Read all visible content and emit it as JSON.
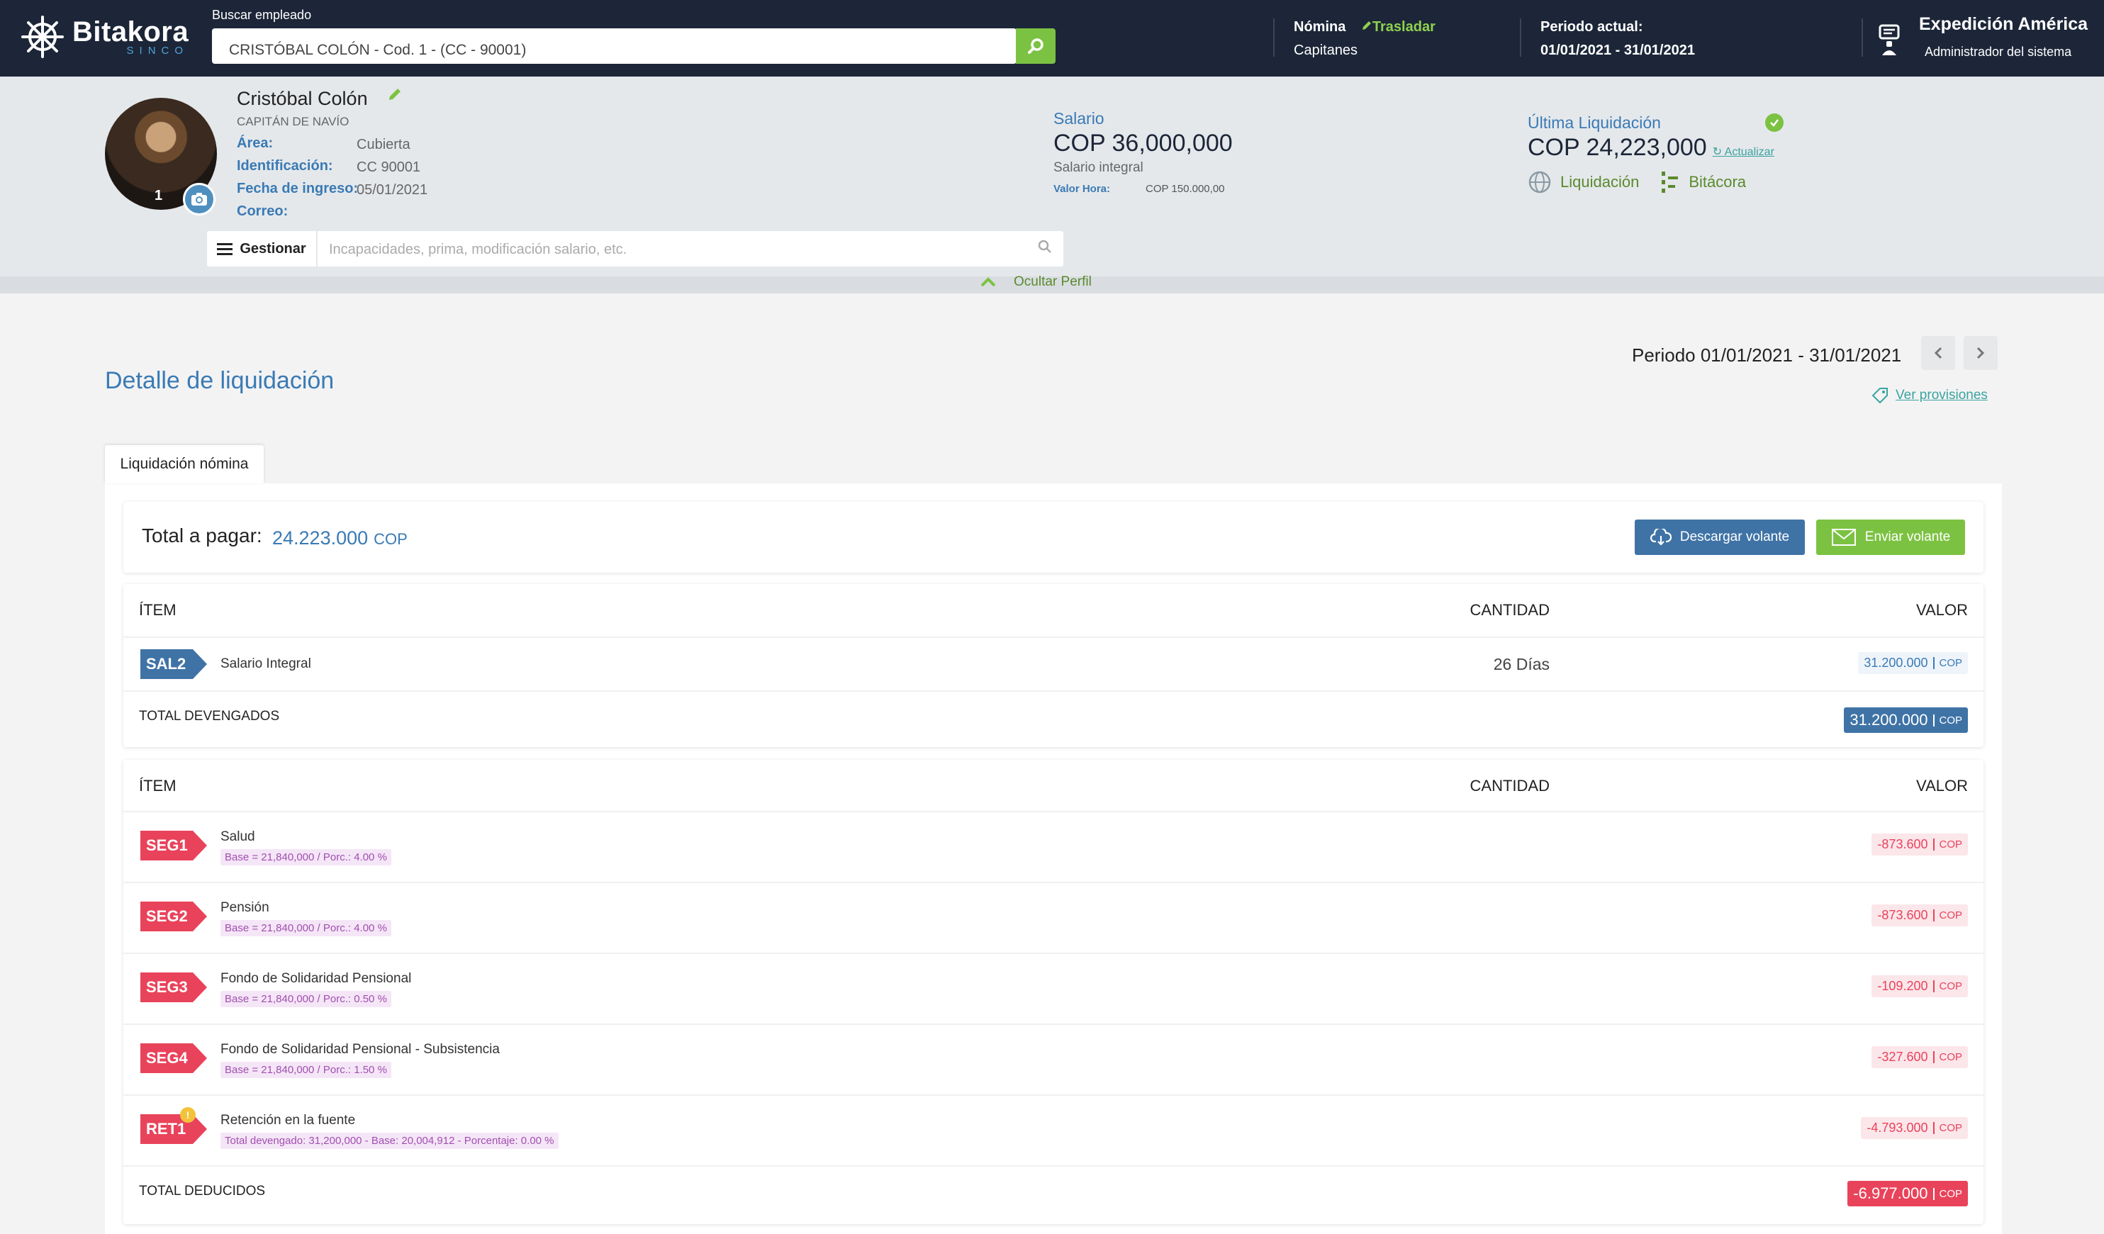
{
  "header": {
    "logo_name": "Bitakora",
    "logo_sub": "SINCO",
    "search_label": "Buscar empleado",
    "search_value": "CRISTÓBAL COLÓN - Cod. 1 - (CC - 90001)",
    "nomina_label": "Nómina",
    "trasladar_label": "Trasladar",
    "nomina_value": "Capitanes",
    "periodo_label": "Periodo actual:",
    "periodo_value": "01/01/2021 - 31/01/2021",
    "user_name": "Expedición América",
    "user_role": "Administrador del sistema"
  },
  "profile": {
    "name": "Cristóbal Colón",
    "role": "CAPITÁN DE NAVÍO",
    "avatar_number": "1",
    "fields": [
      {
        "label": "Área:",
        "value": "Cubierta"
      },
      {
        "label": "Identificación:",
        "value": "CC 90001"
      },
      {
        "label": "Fecha de ingreso:",
        "value": "05/01/2021"
      },
      {
        "label": "Correo:",
        "value": ""
      }
    ],
    "salario_label": "Salario",
    "salario_amount": "COP 36,000,000",
    "salario_type": "Salario integral",
    "valor_hora_label": "Valor Hora:",
    "valor_hora_value": "COP 150.000,00",
    "ultima_label": "Última Liquidación",
    "ultima_amount": "COP 24,223,000",
    "actualizar_label": "Actualizar",
    "liquidacion_link": "Liquidación",
    "bitacora_link": "Bitácora",
    "gestionar_label": "Gestionar",
    "gestionar_placeholder": "Incapacidades, prima, modificación salario, etc.",
    "ocultar_label": "Ocultar Perfil"
  },
  "main": {
    "title": "Detalle de liquidación",
    "periodo": "Periodo 01/01/2021 - 31/01/2021",
    "ver_provisiones": "Ver provisiones",
    "tab_label": "Liquidación nómina",
    "total_label": "Total a pagar:",
    "total_amount": "24.223.000",
    "total_currency": "COP",
    "descargar_label": "Descargar volante",
    "enviar_label": "Enviar volante"
  },
  "devengados": {
    "col_item": "ÍTEM",
    "col_cantidad": "CANTIDAD",
    "col_valor": "VALOR",
    "rows": [
      {
        "code": "SAL2",
        "name": "Salario Integral",
        "qty": "26 Días",
        "value": "31.200.000",
        "cur": "COP"
      }
    ],
    "total_label": "TOTAL DEVENGADOS",
    "total_value": "31.200.000",
    "total_cur": "COP"
  },
  "deducidos": {
    "col_item": "ÍTEM",
    "col_cantidad": "CANTIDAD",
    "col_valor": "VALOR",
    "rows": [
      {
        "code": "SEG1",
        "name": "Salud",
        "tag": "Base = 21,840,000 / Porc.: 4.00 %",
        "value": "-873.600",
        "cur": "COP"
      },
      {
        "code": "SEG2",
        "name": "Pensión",
        "tag": "Base = 21,840,000 / Porc.: 4.00 %",
        "value": "-873.600",
        "cur": "COP"
      },
      {
        "code": "SEG3",
        "name": "Fondo de Solidaridad Pensional",
        "tag": "Base = 21,840,000 / Porc.: 0.50 %",
        "value": "-109.200",
        "cur": "COP"
      },
      {
        "code": "SEG4",
        "name": "Fondo de Solidaridad Pensional - Subsistencia",
        "tag": "Base = 21,840,000 / Porc.: 1.50 %",
        "value": "-327.600",
        "cur": "COP"
      },
      {
        "code": "RET1",
        "name": "Retención en la fuente",
        "tag": "Total devengado: 31,200,000 - Base: 20,004,912 - Porcentaje: 0.00 %",
        "value": "-4.793.000",
        "cur": "COP"
      }
    ],
    "total_label": "TOTAL DEDUCIDOS",
    "total_value": "-6.977.000",
    "total_cur": "COP"
  }
}
